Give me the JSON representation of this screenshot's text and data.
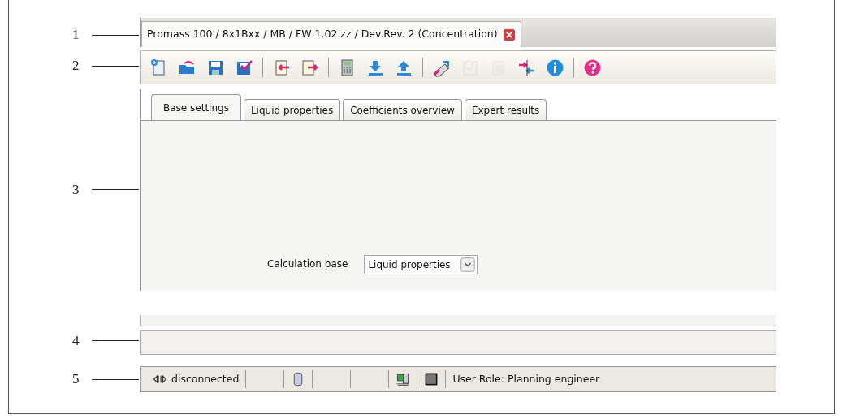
{
  "callouts": [
    "1",
    "2",
    "3",
    "4",
    "5"
  ],
  "window": {
    "title": "Promass 100 / 8x1Bxx / MB / FW 1.02.zz / Dev.Rev. 2  (Concentration)"
  },
  "toolbar": [
    [
      {
        "kind": "new",
        "disabled": false
      },
      {
        "kind": "open",
        "disabled": false
      },
      {
        "kind": "save",
        "disabled": false
      },
      {
        "kind": "save-check",
        "disabled": false
      }
    ],
    [
      {
        "kind": "import",
        "disabled": false
      },
      {
        "kind": "export",
        "disabled": false
      }
    ],
    [
      {
        "kind": "calculator",
        "disabled": false
      },
      {
        "kind": "download",
        "disabled": false
      },
      {
        "kind": "upload",
        "disabled": false
      }
    ],
    [
      {
        "kind": "ruler",
        "disabled": false
      },
      {
        "kind": "clock",
        "disabled": true
      },
      {
        "kind": "page",
        "disabled": true
      },
      {
        "kind": "arrows",
        "disabled": false
      },
      {
        "kind": "info",
        "disabled": false
      }
    ],
    [
      {
        "kind": "help",
        "disabled": false
      }
    ]
  ],
  "tabs": [
    {
      "label": "Base settings",
      "selected": true
    },
    {
      "label": "Liquid properties",
      "selected": false
    },
    {
      "label": "Coefficients overview",
      "selected": false
    },
    {
      "label": "Expert results",
      "selected": false
    }
  ],
  "calculation_base": {
    "label": "Calculation base",
    "value": "Liquid properties"
  },
  "status_bar": [
    {
      "kind": "connection",
      "text": "disconnected"
    },
    {
      "kind": "empty"
    },
    {
      "kind": "cylinder"
    },
    {
      "kind": "empty"
    },
    {
      "kind": "empty"
    },
    {
      "kind": "computer"
    },
    {
      "kind": "square"
    },
    {
      "kind": "text",
      "text": "User Role:  Planning engineer"
    }
  ]
}
